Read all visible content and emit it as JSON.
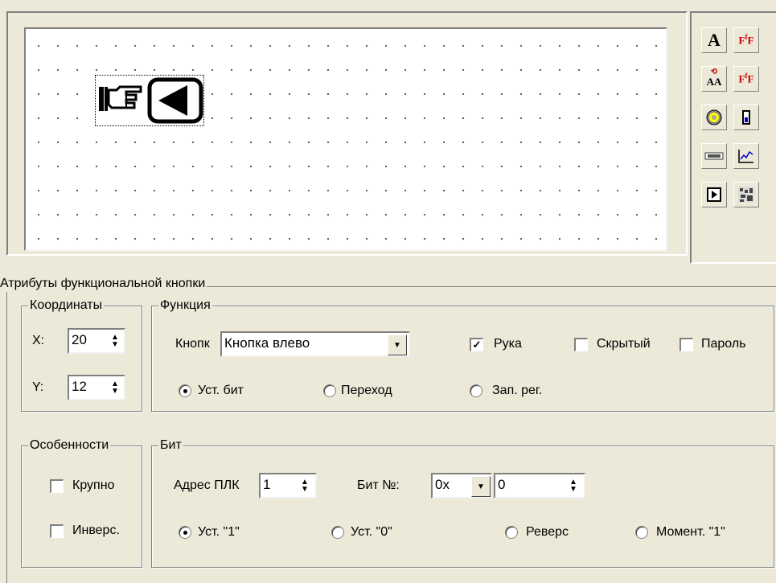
{
  "canvas": {
    "selected_item_icons": [
      "pointing-hand-icon",
      "left-arrow-button-icon"
    ]
  },
  "toolbox": {
    "tools": [
      {
        "name": "text-tool-icon",
        "glyph": "A"
      },
      {
        "name": "font-tool-icon",
        "glyph": "F"
      },
      {
        "name": "text-rotate-tool-icon",
        "glyph": "AA"
      },
      {
        "name": "font-rotate-tool-icon",
        "glyph": "F"
      },
      {
        "name": "lamp-tool-icon",
        "glyph": "◉"
      },
      {
        "name": "switch-tool-icon",
        "glyph": "▮"
      },
      {
        "name": "display-tool-icon",
        "glyph": "▭"
      },
      {
        "name": "trend-tool-icon",
        "glyph": "∿"
      },
      {
        "name": "function-button-tool-icon",
        "glyph": "▶"
      },
      {
        "name": "bitmap-tool-icon",
        "glyph": "▦"
      }
    ]
  },
  "attributes": {
    "title": "Атрибуты функциональной кнопки",
    "coordinates": {
      "title": "Координаты",
      "x_label": "X:",
      "x_value": "20",
      "y_label": "Y:",
      "y_value": "12"
    },
    "function": {
      "title": "Функция",
      "button_label": "Кнопк",
      "button_value": "Кнопка влево",
      "hand_label": "Рука",
      "hand_checked": true,
      "hidden_label": "Скрытый",
      "hidden_checked": false,
      "password_label": "Пароль",
      "password_checked": false,
      "mode_options": [
        "Уст. бит",
        "Переход",
        "Зап. рег."
      ],
      "mode_selected": 0
    },
    "features": {
      "title": "Особенности",
      "large_label": "Крупно",
      "large_checked": false,
      "invert_label": "Инверс.",
      "invert_checked": false
    },
    "bit": {
      "title": "Бит",
      "plc_address_label": "Адрес ПЛК",
      "plc_address_value": "1",
      "bit_no_label": "Бит №:",
      "bit_prefix_value": "0x",
      "bit_value": "0",
      "action_options": [
        "Уст. \"1\"",
        "Уст. \"0\"",
        "Реверс",
        "Момент. \"1\""
      ],
      "action_selected": 0
    }
  }
}
